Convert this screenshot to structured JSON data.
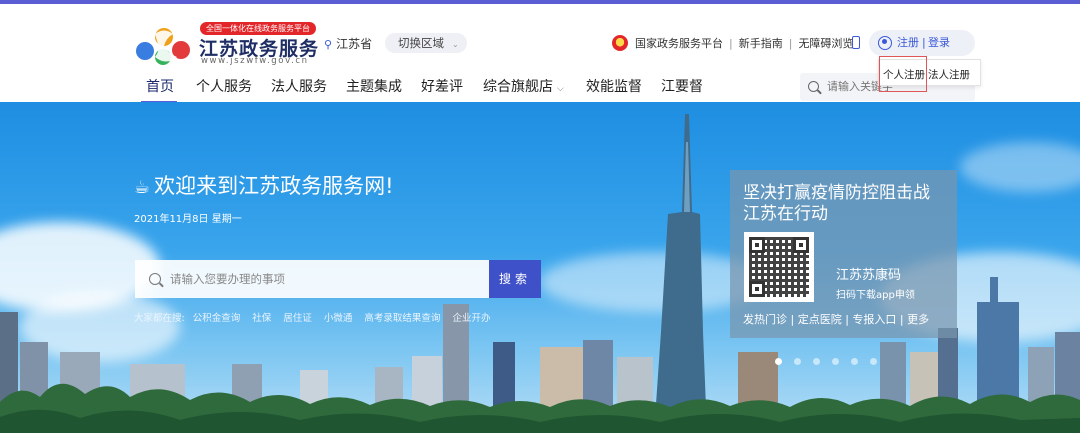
{
  "header": {
    "logo_badge": "全国一体化在线政务服务平台",
    "logo_title": "江苏政务服务",
    "logo_url": "www.jszwfw.gov.cn",
    "location": "江苏省",
    "switch_region": "切换区域",
    "top_links": {
      "national_platform": "国家政务服务平台",
      "guide": "新手指南",
      "accessible": "无障碍浏览"
    },
    "register": "注册",
    "login": "登录",
    "dropdown": {
      "personal_register": "个人注册",
      "legal_register": "法人注册"
    },
    "search_placeholder": "请输入关键字"
  },
  "nav": {
    "items": [
      {
        "label": "首页"
      },
      {
        "label": "个人服务"
      },
      {
        "label": "法人服务"
      },
      {
        "label": "主题集成"
      },
      {
        "label": "好差评"
      },
      {
        "label": "综合旗舰店"
      },
      {
        "label": "效能监督"
      },
      {
        "label": "江要督"
      }
    ]
  },
  "banner": {
    "welcome": "欢迎来到江苏政务服务网!",
    "date": "2021年11月8日 星期一",
    "search_placeholder": "请输入您要办理的事项",
    "search_button": "搜索",
    "hot_label": "大家都在搜:",
    "hot_items": [
      "公积金查询",
      "社保",
      "居住证",
      "小微通",
      "高考录取结果查询",
      "企业开办"
    ],
    "covid": {
      "title_line1": "坚决打赢疫情防控阻击战",
      "title_line2": "江苏在行动",
      "app_name": "江苏苏康码",
      "app_sub": "扫码下载app申领",
      "links": "发热门诊 | 定点医院 | 专报入口 | 更多"
    },
    "carousel_count": 6,
    "carousel_active": 1
  },
  "colors": {
    "accent": "#5a5dd4",
    "brand_blue": "#3f51c9",
    "badge_red": "#e3262a"
  }
}
